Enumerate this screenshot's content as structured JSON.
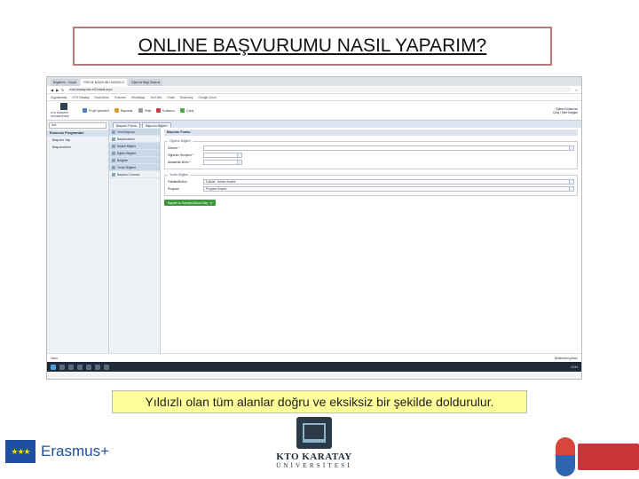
{
  "slide": {
    "title": "ONLINE BAŞVURUMU NASIL YAPARIM?",
    "caption": "Yıldızlı olan tüm alanlar doğru ve eksiksiz bir şekilde doldurulur."
  },
  "browser": {
    "tabs": [
      "Bilgilerim - Sayfa",
      "PROJE BAŞVURU MODÜLÜ",
      "Öğrenci Bilgi Sistemi"
    ],
    "url": "eos.karatay.edu.tr/Default.aspx",
    "bookmarks": [
      "Uygulamalar",
      "KTO Karatay",
      "Excel Anne",
      "Erasmus",
      "WhatsApp",
      "YouTube",
      "Gmail",
      "Dictionary",
      "Google Çeviri"
    ]
  },
  "app": {
    "logo_text": "KTO KARATAY ÜNİVERSİTESİ",
    "toolbar": [
      {
        "label": "Proje İşlemleri",
        "color": "#4a7fc1"
      },
      {
        "label": "Raporlar",
        "color": "#e0a030"
      },
      {
        "label": "Yetki",
        "color": "#999999"
      },
      {
        "label": "Kullanıcı",
        "color": "#c04040"
      },
      {
        "label": "Çıkış",
        "color": "#44aa44"
      }
    ],
    "user_line_1": "Eğitim Kullanıcısı",
    "user_line_2": "Çıkış / Şifre Değiştir",
    "search_placeholder": "Ara",
    "nav_head": "Erasmus Programları",
    "nav_items": [
      "Başvuru Yap",
      "Başvurularım"
    ],
    "content_tabs": [
      "Başvuru Formu",
      "Başvuru Bilgileri"
    ],
    "submenu": [
      {
        "label": "Yeni Başvuru",
        "plain": false
      },
      {
        "label": "Başvurularım",
        "plain": true
      },
      {
        "label": "Kişisel Bilgiler",
        "plain": false
      },
      {
        "label": "Eğitim Bilgileri",
        "plain": false
      },
      {
        "label": "Belgeler",
        "plain": false
      },
      {
        "label": "Tercih Bilgileri",
        "plain": false
      },
      {
        "label": "Başvuru Durumu",
        "plain": true
      }
    ],
    "page_header": "Başvuru Formu",
    "group1_legend": "Öğrenci Bilgileri",
    "group1_fields": [
      {
        "label": "Dönem *",
        "value": ""
      },
      {
        "label": "Öğrenim Seviyesi *",
        "value": ""
      },
      {
        "label": "Akademik Birim *",
        "value": ""
      }
    ],
    "group2_legend": "Tercih Bilgileri",
    "group2_fields": [
      {
        "label": "Fakülte/Bölüm",
        "value": "Fakülte - Bölüm Seçiniz"
      },
      {
        "label": "Program",
        "value": "Program Seçiniz"
      }
    ],
    "save_label": "Kaydet ve Sonraki Adıma Geç",
    "status_left": "Hazır",
    "status_right": "Bildirimleri göster",
    "clock": "10:54"
  },
  "logos": {
    "erasmus": "Erasmus+",
    "kto_name": "KTO KARATAY",
    "kto_sub": "ÜNİVERSİTESİ"
  }
}
